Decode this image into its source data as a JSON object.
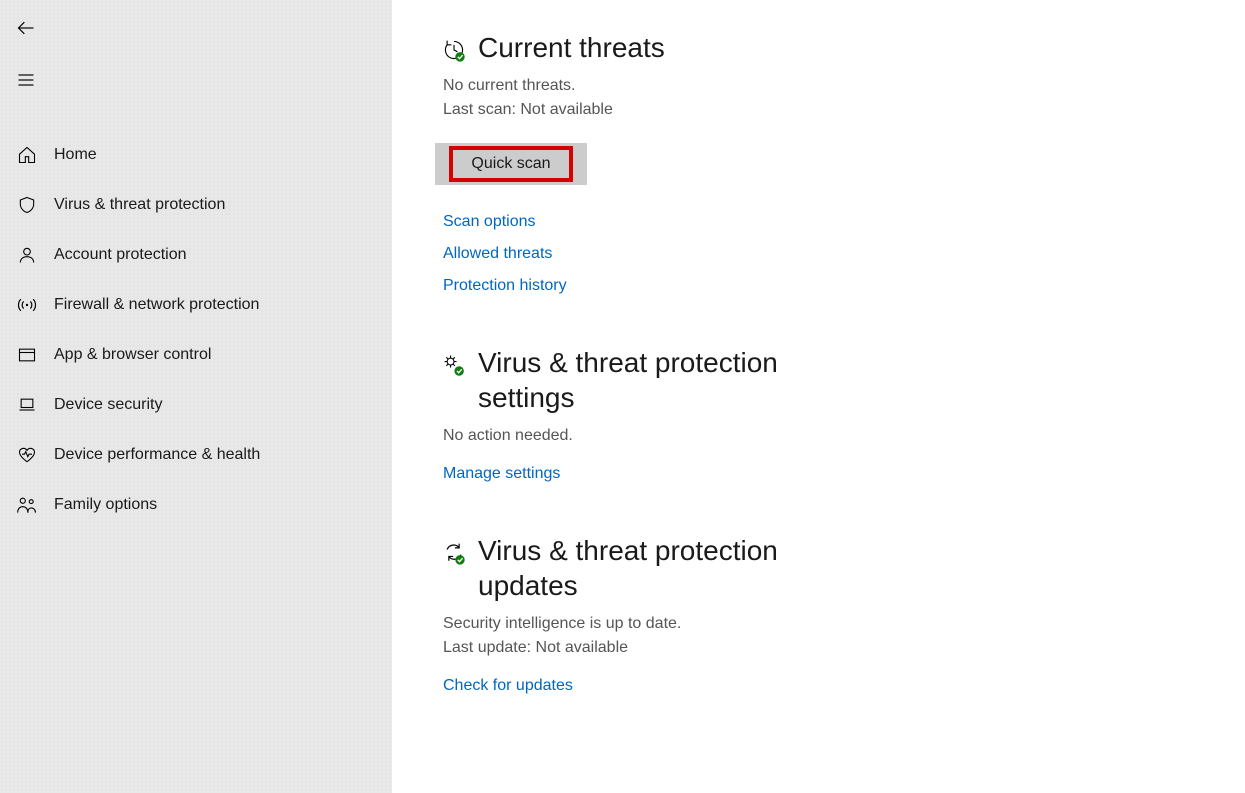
{
  "sidebar": {
    "items": [
      {
        "label": "Home"
      },
      {
        "label": "Virus & threat protection"
      },
      {
        "label": "Account protection"
      },
      {
        "label": "Firewall & network protection"
      },
      {
        "label": "App & browser control"
      },
      {
        "label": "Device security"
      },
      {
        "label": "Device performance & health"
      },
      {
        "label": "Family options"
      }
    ]
  },
  "main": {
    "threats": {
      "title": "Current threats",
      "status1": "No current threats.",
      "status2": "Last scan: Not available",
      "button": "Quick scan",
      "links": {
        "scan_options": "Scan options",
        "allowed_threats": "Allowed threats",
        "protection_history": "Protection history"
      }
    },
    "settings": {
      "title": "Virus & threat protection settings",
      "status": "No action needed.",
      "link": "Manage settings"
    },
    "updates": {
      "title": "Virus & threat protection updates",
      "status1": "Security intelligence is up to date.",
      "status2": "Last update: Not available",
      "link": "Check for updates"
    }
  }
}
